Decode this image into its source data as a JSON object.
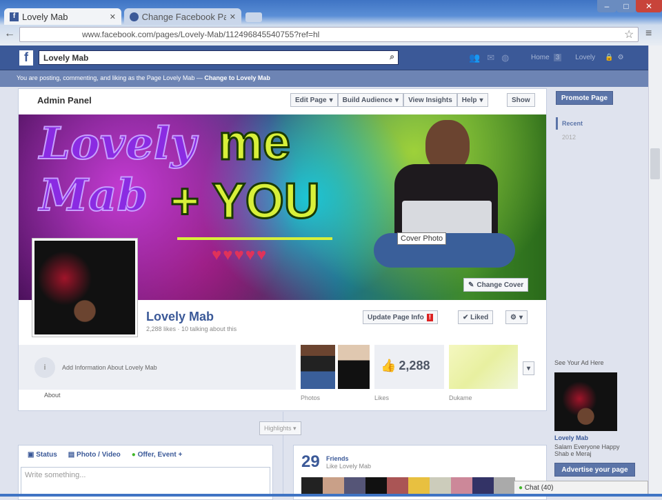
{
  "browser": {
    "tabs": [
      {
        "label": "Lovely Mab"
      },
      {
        "label": "Change Facebook Pa"
      }
    ],
    "url": "www.facebook.com/pages/Lovely-Mab/112496845540755?ref=hl"
  },
  "fb": {
    "search_value": "Lovely Mab",
    "nav": {
      "home": "Home",
      "home_count": "3",
      "user": "Lovely"
    },
    "notice": "You are posting, commenting, and liking as the Page Lovely Mab — ",
    "notice_link": "Change to Lovely Mab"
  },
  "admin": {
    "title": "Admin Panel",
    "buttons": [
      "Edit Page",
      "Build Audience",
      "View Insights",
      "Help"
    ],
    "show": "Show"
  },
  "cover": {
    "text1": "Lovely",
    "text2": "Mab",
    "text3": "me",
    "text4": "+ YOU",
    "tooltip": "Cover Photo",
    "change": "Change Cover"
  },
  "page": {
    "name": "Lovely Mab",
    "stats": "2,288 likes · 10 talking about this",
    "update": "Update Page Info",
    "update_badge": "!",
    "liked": "✔ Liked"
  },
  "about": {
    "info": "Add Information About Lovely Mab",
    "label": "About",
    "photos": "Photos",
    "likes_label": "Likes",
    "likes": "2,288",
    "app": "Dukame"
  },
  "highlights": "Highlights ▾",
  "composer": {
    "tabs": [
      "Status",
      "Photo / Video",
      "Offer, Event +"
    ],
    "placeholder": "Write something..."
  },
  "friends": {
    "count": "29",
    "label": "Friends",
    "sub": "Like Lovely Mab"
  },
  "right": {
    "promote": "Promote Page",
    "recent": "Recent",
    "year": "2012",
    "ad_title": "See Your Ad Here",
    "ad_name": "Lovely Mab",
    "ad_text": "Salam Everyone Happy Shab e Meraj",
    "advertise": "Advertise your page"
  },
  "chat": "Chat (40)"
}
